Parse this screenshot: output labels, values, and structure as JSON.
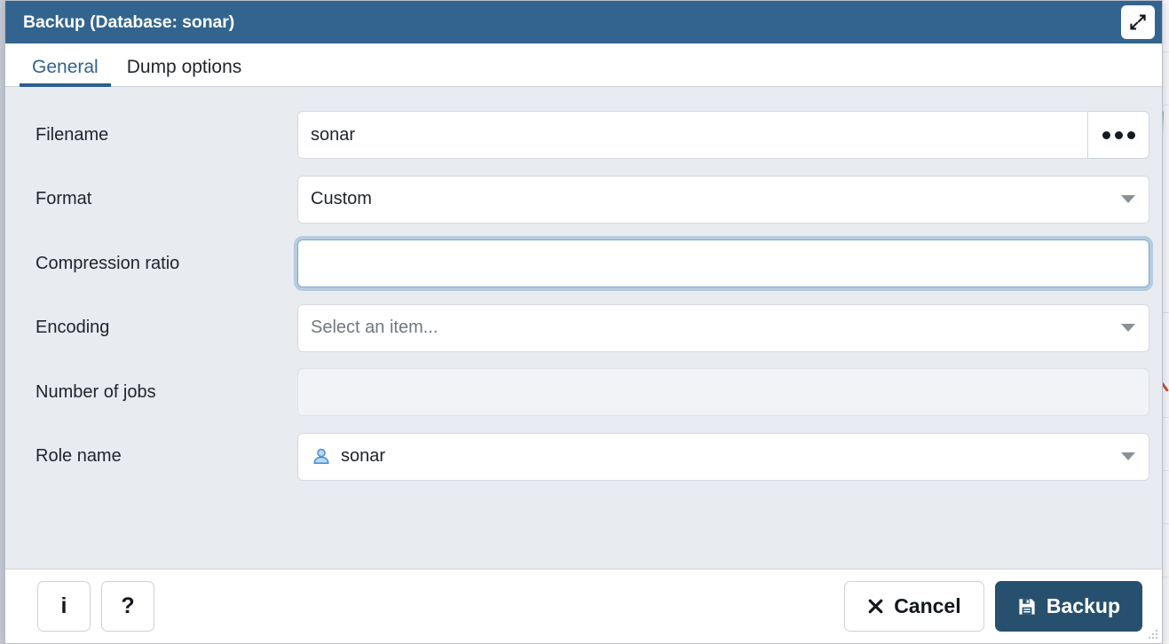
{
  "window": {
    "title": "Backup (Database: sonar)",
    "maximize_icon": "expand-diagonal-icon",
    "titlebar_color": "#32648f"
  },
  "tabs": [
    {
      "label": "General",
      "active": true
    },
    {
      "label": "Dump options",
      "active": false
    }
  ],
  "form": {
    "rows": [
      {
        "label": "Filename",
        "type": "text-with-browse",
        "value": "sonar",
        "placeholder": "",
        "browse_label": "...",
        "state": "normal"
      },
      {
        "label": "Format",
        "type": "select",
        "value": "Custom",
        "placeholder": "",
        "state": "normal"
      },
      {
        "label": "Compression ratio",
        "type": "text",
        "value": "",
        "placeholder": "",
        "state": "focused"
      },
      {
        "label": "Encoding",
        "type": "select",
        "value": "Select an item...",
        "placeholder": "Select an item...",
        "state": "placeholder"
      },
      {
        "label": "Number of jobs",
        "type": "text",
        "value": "",
        "placeholder": "",
        "state": "disabled"
      },
      {
        "label": "Role name",
        "type": "select-with-icon",
        "value": "sonar",
        "icon": "user-icon",
        "state": "normal"
      }
    ]
  },
  "footer": {
    "info_label": "i",
    "help_label": "?",
    "cancel_label": "Cancel",
    "cancel_icon": "cross-icon",
    "backup_label": "Backup",
    "backup_icon": "save-floppy-icon",
    "backup_color": "#27506f"
  }
}
